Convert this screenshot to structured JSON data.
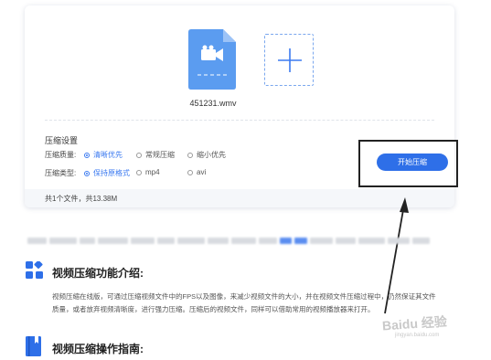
{
  "file": {
    "name": "451231.wmv",
    "icon": "video-file-icon",
    "color": "#5b9cf0"
  },
  "add_button": {
    "icon": "plus-icon"
  },
  "settings": {
    "title": "压缩设置",
    "quality": {
      "label": "压缩质量:",
      "options": [
        {
          "label": "清晰优先",
          "selected": true
        },
        {
          "label": "常规压缩",
          "selected": false
        },
        {
          "label": "缩小优先",
          "selected": false
        }
      ]
    },
    "type": {
      "label": "压缩类型:",
      "options": [
        {
          "label": "保持原格式",
          "selected": true
        },
        {
          "label": "mp4",
          "selected": false
        },
        {
          "label": "avi",
          "selected": false
        }
      ]
    }
  },
  "start_button": {
    "label": "开始压缩",
    "color": "#2e6fe8"
  },
  "footer": {
    "summary": "共1个文件，共13.38M"
  },
  "intro": {
    "heading": "视频压缩功能介绍:",
    "icon": "grid-icon",
    "paragraph_line1": "视频压缩在线版，可通过压缩视频文件中的FPS以及图像，来减少视频文件的大小，并在视频文件压缩过程中，仍然保证其文件",
    "paragraph_line2": "质量，或者放弃视频清晰度，进行强力压缩。压缩后的视频文件，同样可以借助常用的视频播放器来打开。"
  },
  "guide": {
    "heading": "视频压缩操作指南:",
    "icon": "book-icon"
  },
  "watermark": {
    "text": "Baidu 经验",
    "sub": "jingyan.baidu.com"
  }
}
